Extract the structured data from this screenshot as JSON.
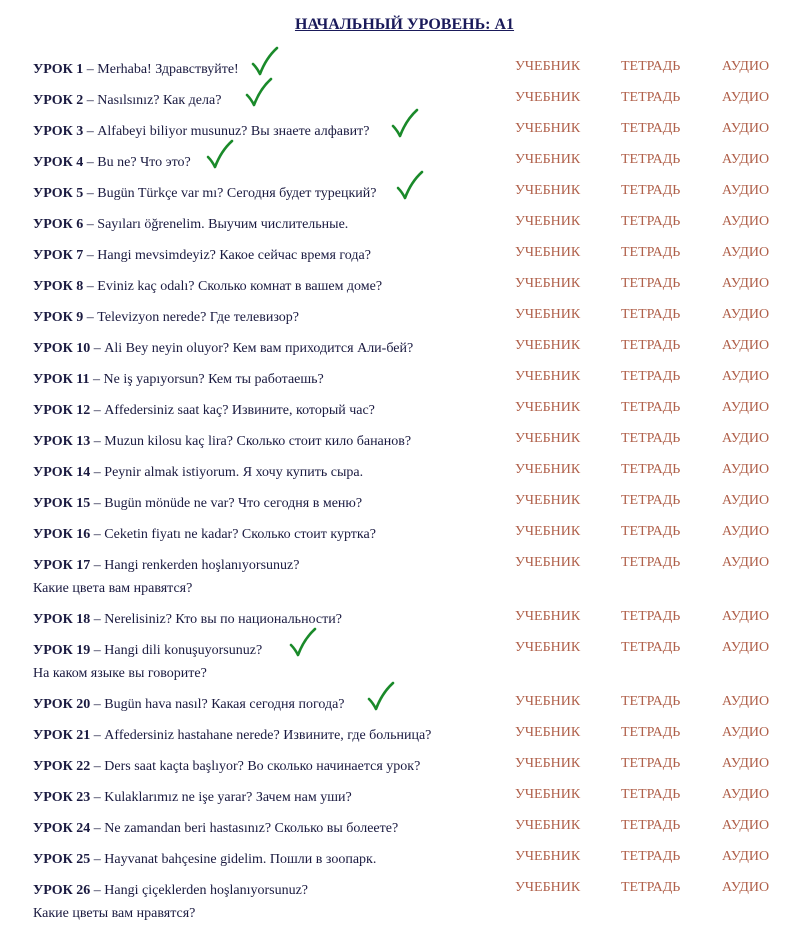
{
  "page": {
    "title": "НАЧАЛЬНЫЙ УРОВЕНЬ: А1",
    "link_labels": {
      "textbook": "УЧЕБНИК",
      "workbook": "ТЕТРАДЬ",
      "audio": "АУДИО"
    },
    "colors": {
      "link": "#b0604a",
      "text": "#1a1a40",
      "checkmark": "#1a8a2a"
    }
  },
  "lessons": [
    {
      "num": "УРОК 1",
      "text": "Merhaba! Здравствуйте!",
      "completed": true
    },
    {
      "num": "УРОК 2",
      "text": "Nasılsınız? Как дела?",
      "completed": true
    },
    {
      "num": "УРОК 3",
      "text": "Alfabeyi biliyor musunuz? Вы знаете алфавит?",
      "completed": true
    },
    {
      "num": "УРОК 4",
      "text": "Bu ne? Что это?",
      "completed": true
    },
    {
      "num": "УРОК 5",
      "text": "Bugün Türkçe var mı? Сегодня будет турецкий?",
      "completed": true
    },
    {
      "num": "УРОК 6",
      "text": "Sayıları öğrenelim. Выучим числительные.",
      "completed": false
    },
    {
      "num": "УРОК 7",
      "text": "Hangi mevsimdeyiz? Какое сейчас время года?",
      "completed": false
    },
    {
      "num": "УРОК 8",
      "text": "Evi­niz kaç odalı? Сколько комнат в вашем доме?",
      "completed": false
    },
    {
      "num": "УРОК 9",
      "text": "Televizyon nerede? Где телевизор?",
      "completed": false
    },
    {
      "num": "УРОК 10",
      "text": "Ali Bey neyin oluyor? Кем вам приходится Али-бей?",
      "completed": false
    },
    {
      "num": "УРОК 11",
      "text": "Ne iş yapıyorsun? Кем ты работаешь?",
      "completed": false
    },
    {
      "num": "УРОК 12",
      "text": "Affedersiniz saat kaç? Извините, который час?",
      "completed": false
    },
    {
      "num": "УРОК 13",
      "text": "Muzun kilosu kaç lira? Сколько стоит кило бананов?",
      "completed": false
    },
    {
      "num": "УРОК 14",
      "text": "Peynir almak istiyorum. Я хочу купить сыра.",
      "completed": false
    },
    {
      "num": "УРОК 15",
      "text": "Bugün mönüde ne var? Что сегодня в меню?",
      "completed": false
    },
    {
      "num": "УРОК 16",
      "text": "Ceketin fiyatı ne kadar? Сколько стоит куртка?",
      "completed": false
    },
    {
      "num": "УРОК 17",
      "text": "Hangi renkerden hoşlanıyorsunuz?",
      "text2": "Какие цвета вам нравятся?",
      "completed": false
    },
    {
      "num": "УРОК 18",
      "text": "Nerelisiniz? Кто вы по национальности?",
      "completed": false
    },
    {
      "num": "УРОК 19",
      "text": "Hangi dili konuşuyorsunuz?",
      "text2": "На каком языке вы говорите?",
      "completed": true
    },
    {
      "num": "УРОК 20",
      "text": "Bugün hava nasıl? Какая сегодня погода?",
      "completed": true
    },
    {
      "num": "УРОК 21",
      "text": "Affedersiniz hastahane nerede? Извините, где больница?",
      "completed": false
    },
    {
      "num": "УРОК 22",
      "text": "Ders saat kaçta başlıyor? Во сколько начинается урок?",
      "completed": false
    },
    {
      "num": "УРОК 23",
      "text": "Kulaklarımız ne işe yarar? Зачем нам уши?",
      "completed": false
    },
    {
      "num": "УРОК 24",
      "text": "Ne zamandan beri hastasınız? Сколько вы болеете?",
      "completed": false
    },
    {
      "num": "УРОК 25",
      "text": "Hayvanat bahçesine gidelim. Пошли в зоопарк.",
      "completed": false
    },
    {
      "num": "УРОК 26",
      "text": "Hangi çiçeklerden hoşlanıyorsunuz?",
      "text2": "Какие цветы вам нравятся?",
      "completed": false
    }
  ]
}
